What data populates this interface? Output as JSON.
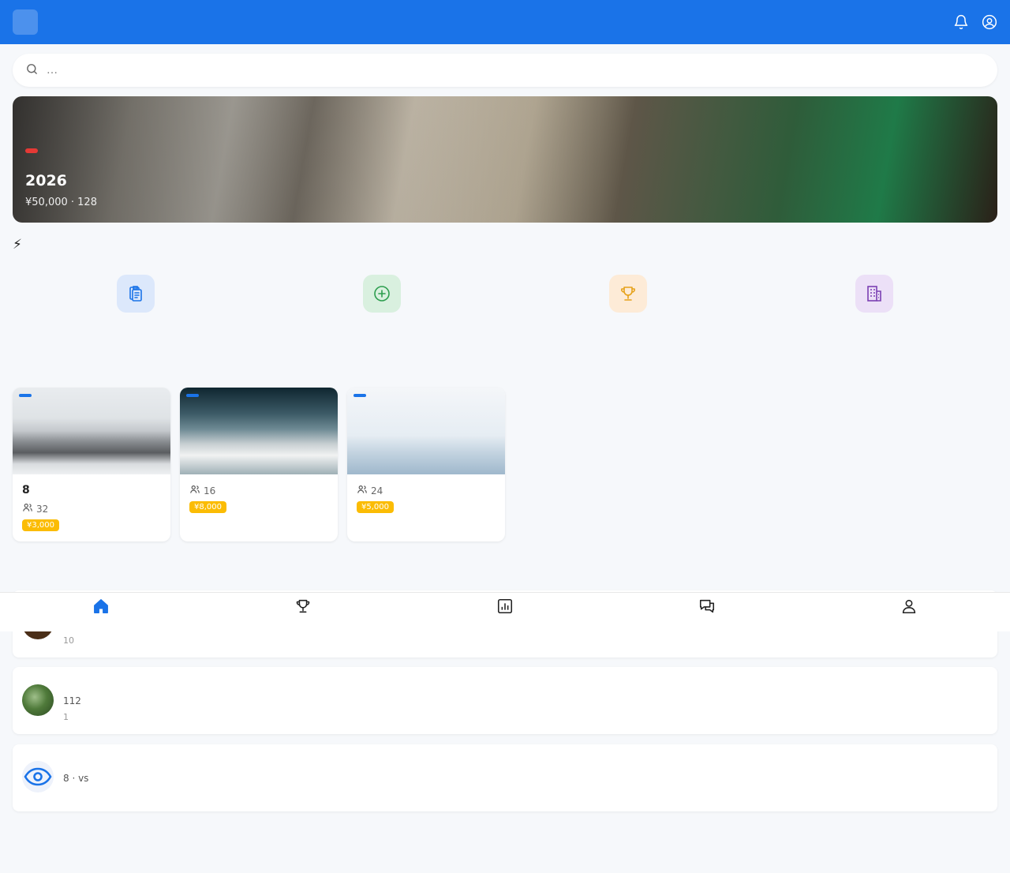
{
  "header": {
    "logo_glyph": "",
    "title": "",
    "bell_icon": "bell-icon",
    "profile_icon": "user-circle-icon"
  },
  "search": {
    "placeholder": "…"
  },
  "banner": {
    "tag": "",
    "title": "2026",
    "subtitle": "¥50,000 · 128"
  },
  "quick_actions": {
    "title": "⚡",
    "more": "",
    "items": [
      {
        "label": "",
        "icon": "clipboard-icon",
        "bg": "#dce8fb",
        "color": "#1a73e8"
      },
      {
        "label": "",
        "icon": "plus-circle-icon",
        "bg": "#d9f0df",
        "color": "#2e9e4f"
      },
      {
        "label": "",
        "icon": "trophy-icon",
        "bg": "#fdebd7",
        "color": "#e6a21b"
      },
      {
        "label": "",
        "icon": "building-icon",
        "bg": "#ece0f7",
        "color": "#7b3fb3"
      }
    ]
  },
  "featured": {
    "title": "",
    "more": "",
    "cards": [
      {
        "badge": "",
        "title": "8",
        "participants": "32",
        "prize": "¥3,000"
      },
      {
        "badge": "",
        "title": "",
        "participants": "16",
        "prize": "¥8,000"
      },
      {
        "badge": "",
        "title": "",
        "participants": "24",
        "prize": "¥5,000"
      }
    ]
  },
  "activity": {
    "title": "",
    "more": "",
    "items": [
      {
        "title": "",
        "desc": "",
        "time": "10"
      },
      {
        "title": " ",
        "desc": "112",
        "time": "1"
      },
      {
        "title": "",
        "desc": "8 ·  vs ",
        "time": ""
      }
    ]
  },
  "bottom_nav": [
    {
      "label": "",
      "icon": "home-icon",
      "active": true
    },
    {
      "label": "",
      "icon": "trophy-icon",
      "active": false
    },
    {
      "label": "",
      "icon": "bar-chart-icon",
      "active": false
    },
    {
      "label": "",
      "icon": "chat-icon",
      "active": false
    },
    {
      "label": "",
      "icon": "user-icon",
      "active": false
    }
  ],
  "colors": {
    "primary": "#1a73e8",
    "danger": "#e53935",
    "prize": "#fbbc04",
    "background": "#f6f8fb"
  }
}
